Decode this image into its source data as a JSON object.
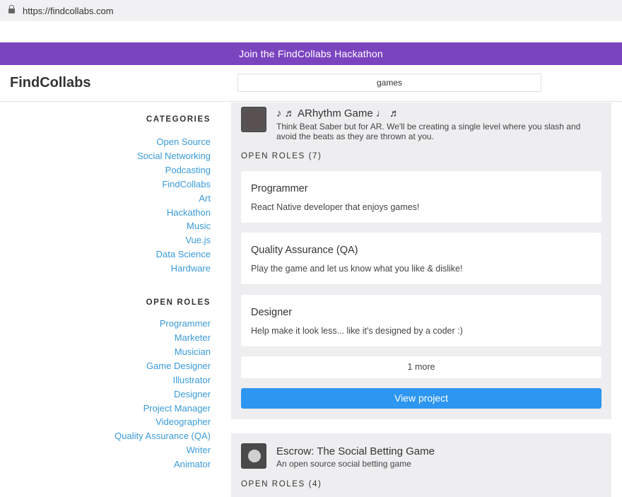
{
  "browser": {
    "url": "https://findcollabs.com"
  },
  "banner": {
    "text": "Join the FindCollabs Hackathon"
  },
  "header": {
    "logo": "FindCollabs",
    "search_value": "games"
  },
  "sidebar": {
    "categories_heading": "CATEGORIES",
    "categories": [
      "Open Source",
      "Social Networking",
      "Podcasting",
      "FindCollabs",
      "Art",
      "Hackathon",
      "Music",
      "Vue.js",
      "Data Science",
      "Hardware"
    ],
    "roles_heading": "OPEN ROLES",
    "roles": [
      "Programmer",
      "Marketer",
      "Musician",
      "Game Designer",
      "Illustrator",
      "Designer",
      "Project Manager",
      "Videographer",
      "Quality Assurance (QA)",
      "Writer",
      "Animator"
    ]
  },
  "projects": [
    {
      "title": "♪ ♬ ARhythm Game ♩ ♬",
      "description": "Think Beat Saber but for AR. We'll be creating a single level where you slash and avoid the beats as they are thrown at you.",
      "roles_heading": "OPEN ROLES (7)",
      "roles": [
        {
          "title": "Programmer",
          "description": "React Native developer that enjoys games!"
        },
        {
          "title": "Quality Assurance (QA)",
          "description": "Play the game and let us know what you like & dislike!"
        },
        {
          "title": "Designer",
          "description": "Help make it look less... like it's designed by a coder :)"
        }
      ],
      "more_label": "1 more",
      "view_label": "View project"
    },
    {
      "title": "Escrow: The Social Betting Game",
      "description": "An open source social betting game",
      "roles_heading": "OPEN ROLES (4)"
    }
  ]
}
